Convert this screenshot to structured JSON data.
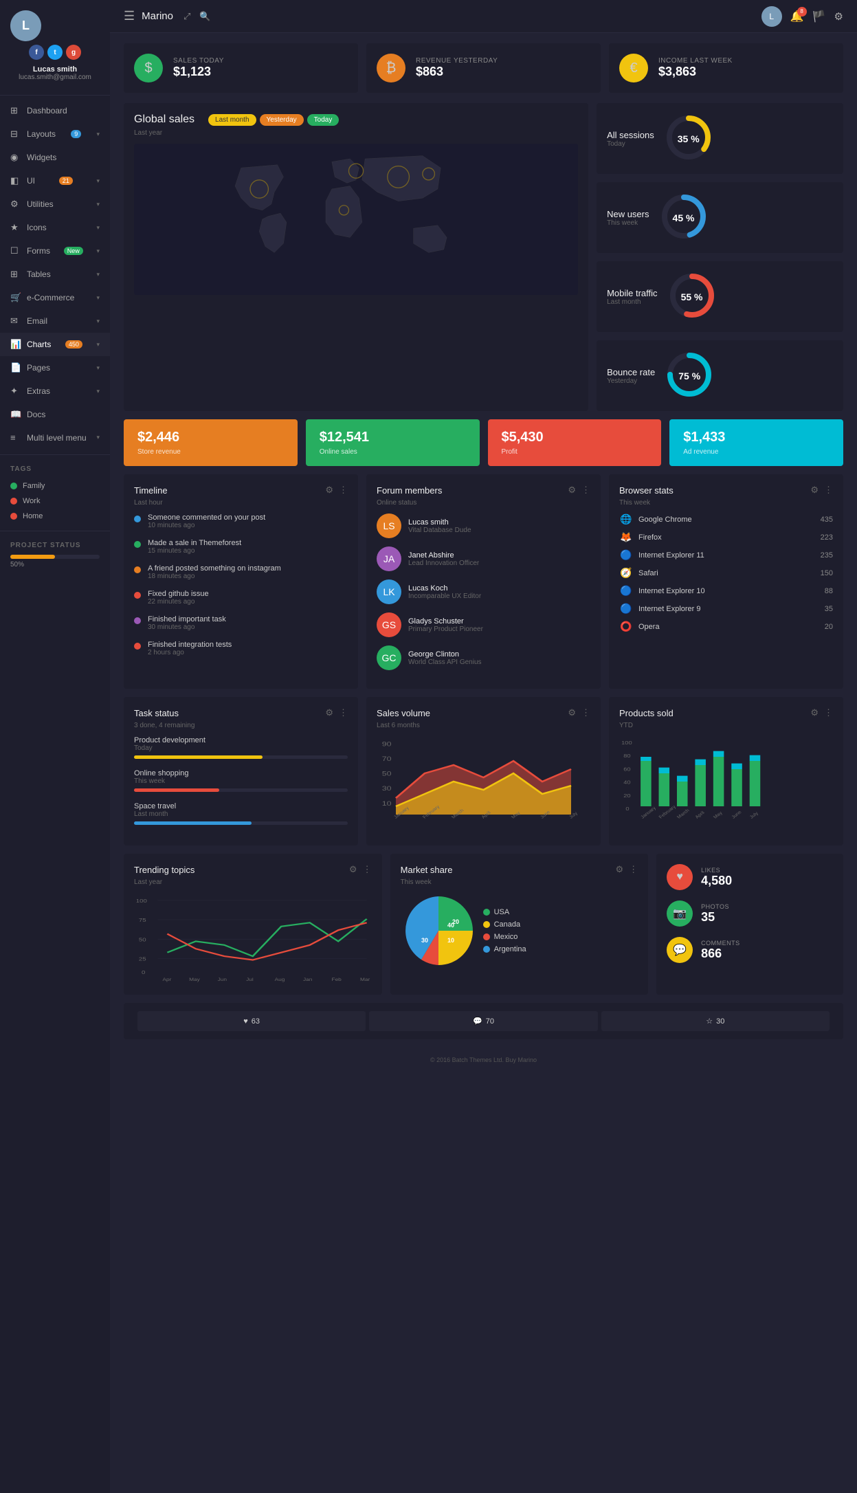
{
  "topbar": {
    "title": "Marino",
    "bell_count": "8"
  },
  "sidebar": {
    "username": "Lucas smith",
    "email": "lucas.smith@gmail.com",
    "nav_items": [
      {
        "label": "Dashboard",
        "icon": "⊞",
        "badge": null
      },
      {
        "label": "Layouts",
        "icon": "⊟",
        "badge": "9",
        "badge_color": "blue"
      },
      {
        "label": "Widgets",
        "icon": "◉",
        "badge": null
      },
      {
        "label": "UI",
        "icon": "◧",
        "badge": "21",
        "badge_color": "orange"
      },
      {
        "label": "Utilities",
        "icon": "⚙",
        "badge": null
      },
      {
        "label": "Icons",
        "icon": "★",
        "badge": null
      },
      {
        "label": "Forms",
        "icon": "☐",
        "badge": "New",
        "badge_color": "green"
      },
      {
        "label": "Tables",
        "icon": "⊞",
        "badge": null
      },
      {
        "label": "e-Commerce",
        "icon": "🛒",
        "badge": null
      },
      {
        "label": "Email",
        "icon": "✉",
        "badge": null
      },
      {
        "label": "Charts",
        "icon": "📊",
        "badge": "450",
        "badge_color": "orange"
      },
      {
        "label": "Pages",
        "icon": "📄",
        "badge": null
      },
      {
        "label": "Extras",
        "icon": "✦",
        "badge": null
      },
      {
        "label": "Docs",
        "icon": "📖",
        "badge": null
      },
      {
        "label": "Multi level menu",
        "icon": "≡",
        "badge": null
      }
    ],
    "tags": [
      {
        "label": "Family",
        "color": "#27ae60"
      },
      {
        "label": "Work",
        "color": "#e74c3c"
      },
      {
        "label": "Home",
        "color": "#e74c3c"
      }
    ],
    "project_status": {
      "label": "PROJECT STATUS",
      "percent": 50
    }
  },
  "stats": [
    {
      "label": "SALES TODAY",
      "value": "$1,123",
      "icon": "$",
      "color": "green"
    },
    {
      "label": "REVENUE YESTERDAY",
      "value": "$863",
      "icon": "₿",
      "color": "orange"
    },
    {
      "label": "INCOME LAST WEEK",
      "value": "$3,863",
      "icon": "€",
      "color": "yellow"
    }
  ],
  "global_sales": {
    "title": "Global sales",
    "subtitle": "Last year",
    "tabs": [
      "Last month",
      "Yesterday",
      "Today"
    ]
  },
  "sessions": [
    {
      "label": "All sessions",
      "sublabel": "Today",
      "percent": "35 %",
      "color": "#f1c40f",
      "track": "#2a2a3d"
    },
    {
      "label": "New users",
      "sublabel": "This week",
      "percent": "45 %",
      "color": "#3498db",
      "track": "#2a2a3d"
    },
    {
      "label": "Mobile traffic",
      "sublabel": "Last month",
      "percent": "55 %",
      "color": "#e74c3c",
      "track": "#2a2a3d"
    },
    {
      "label": "Bounce rate",
      "sublabel": "Yesterday",
      "percent": "75 %",
      "color": "#00bcd4",
      "track": "#2a2a3d"
    }
  ],
  "revenue_cards": [
    {
      "value": "$2,446",
      "label": "Store revenue",
      "color": "orange"
    },
    {
      "value": "$12,541",
      "label": "Online sales",
      "color": "green"
    },
    {
      "value": "$5,430",
      "label": "Profit",
      "color": "red"
    },
    {
      "value": "$1,433",
      "label": "Ad revenue",
      "color": "cyan"
    }
  ],
  "timeline": {
    "title": "Timeline",
    "subtitle": "Last hour",
    "items": [
      {
        "text": "Someone commented on your post",
        "time": "10 minutes ago",
        "dot": "blue"
      },
      {
        "text": "Made a sale in Themeforest",
        "time": "15 minutes ago",
        "dot": "green"
      },
      {
        "text": "A friend posted something on instagram",
        "time": "18 minutes ago",
        "dot": "orange"
      },
      {
        "text": "Fixed github issue",
        "time": "22 minutes ago",
        "dot": "red"
      },
      {
        "text": "Finished important task",
        "time": "30 minutes ago",
        "dot": "purple"
      },
      {
        "text": "Finished integration tests",
        "time": "2 hours ago",
        "dot": "red"
      }
    ]
  },
  "forum_members": {
    "title": "Forum members",
    "subtitle": "Online status",
    "members": [
      {
        "name": "Lucas smith",
        "role": "Vital Database Dude",
        "initials": "LS",
        "color": "#e67e22"
      },
      {
        "name": "Janet Abshire",
        "role": "Lead Innovation Officer",
        "initials": "JA",
        "color": "#9b59b6"
      },
      {
        "name": "Lucas Koch",
        "role": "Incomparable UX Editor",
        "initials": "LK",
        "color": "#3498db"
      },
      {
        "name": "Gladys Schuster",
        "role": "Primary Product Pioneer",
        "initials": "GS",
        "color": "#e74c3c"
      },
      {
        "name": "George Clinton",
        "role": "World Class API Genius",
        "initials": "GC",
        "color": "#27ae60"
      }
    ]
  },
  "browser_stats": {
    "title": "Browser stats",
    "subtitle": "This week",
    "items": [
      {
        "name": "Google Chrome",
        "count": "435",
        "icon": "🌐"
      },
      {
        "name": "Firefox",
        "count": "223",
        "icon": "🦊"
      },
      {
        "name": "Internet Explorer 11",
        "count": "235",
        "icon": "🔵"
      },
      {
        "name": "Safari",
        "count": "150",
        "icon": "🧭"
      },
      {
        "name": "Internet Explorer 10",
        "count": "88",
        "icon": "🔵"
      },
      {
        "name": "Internet Explorer 9",
        "count": "35",
        "icon": "🔵"
      },
      {
        "name": "Opera",
        "count": "20",
        "icon": "⭕"
      }
    ]
  },
  "task_status": {
    "title": "Task status",
    "subtitle": "3 done, 4 remaining",
    "items": [
      {
        "name": "Product development",
        "sub": "Today",
        "percent": 60,
        "color": "#f1c40f"
      },
      {
        "name": "Online shopping",
        "sub": "This week",
        "percent": 40,
        "color": "#e74c3c"
      },
      {
        "name": "Space travel",
        "sub": "Last month",
        "percent": 55,
        "color": "#3498db"
      }
    ]
  },
  "sales_volume": {
    "title": "Sales volume",
    "subtitle": "Last 6 months",
    "labels": [
      "January",
      "February",
      "March",
      "April",
      "May",
      "June",
      "July"
    ]
  },
  "products_sold": {
    "title": "Products sold",
    "subtitle": "YTD",
    "labels": [
      "January",
      "February",
      "March",
      "April",
      "May",
      "June",
      "July"
    ],
    "y_max": 100
  },
  "trending": {
    "title": "Trending topics",
    "subtitle": "Last year",
    "labels": [
      "Apr",
      "May",
      "Jun",
      "Jul",
      "Aug",
      "Jan",
      "Feb",
      "Mar"
    ]
  },
  "market_share": {
    "title": "Market share",
    "subtitle": "This week",
    "items": [
      {
        "label": "USA",
        "color": "#27ae60",
        "value": 40
      },
      {
        "label": "Canada",
        "color": "#f1c40f",
        "value": 20
      },
      {
        "label": "Mexico",
        "color": "#e74c3c",
        "value": 10
      },
      {
        "label": "Argentina",
        "color": "#3498db",
        "value": 30
      }
    ]
  },
  "social_counts": [
    {
      "label": "LIKES",
      "value": "4,580",
      "icon": "♥",
      "color": "red"
    },
    {
      "label": "PHOTOS",
      "value": "35",
      "icon": "📷",
      "color": "green"
    },
    {
      "label": "COMMENTS",
      "value": "866",
      "icon": "💬",
      "color": "yellow"
    }
  ],
  "bottom_actions": [
    {
      "label": "63",
      "icon": "♥"
    },
    {
      "label": "70",
      "icon": "💬"
    },
    {
      "label": "30",
      "icon": "☆"
    }
  ],
  "footer": "© 2016 Batch Themes Ltd. Buy Marino"
}
